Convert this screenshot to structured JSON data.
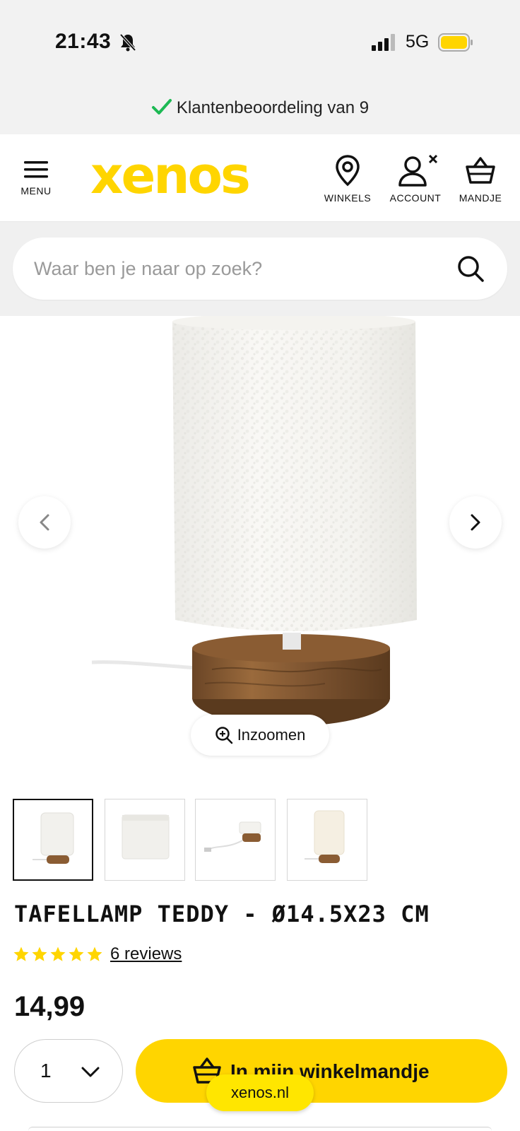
{
  "status_bar": {
    "time": "21:43",
    "network": "5G",
    "battery_color": "#ffd500"
  },
  "trust_banner": {
    "text": "Klantenbeoordeling van 9",
    "check_color": "#1db954"
  },
  "header": {
    "menu_label": "MENU",
    "logo_text": "xenos",
    "brand_color": "#ffd500",
    "stores_label": "WINKELS",
    "account_label": "ACCOUNT",
    "cart_label": "MANDJE"
  },
  "search": {
    "placeholder": "Waar ben je naar op zoek?"
  },
  "gallery": {
    "zoom_label": "Inzoomen",
    "thumbnail_count": 4,
    "active_thumbnail": 1
  },
  "product": {
    "title": "TAFELLAMP TEDDY - Ø14.5X23 CM",
    "rating_stars": 5,
    "reviews_label": "6 reviews",
    "price": "14,99"
  },
  "purchase": {
    "quantity": "1",
    "add_to_cart_label": "In mijn winkelmandje"
  },
  "browser": {
    "url_label": "xenos.nl"
  }
}
